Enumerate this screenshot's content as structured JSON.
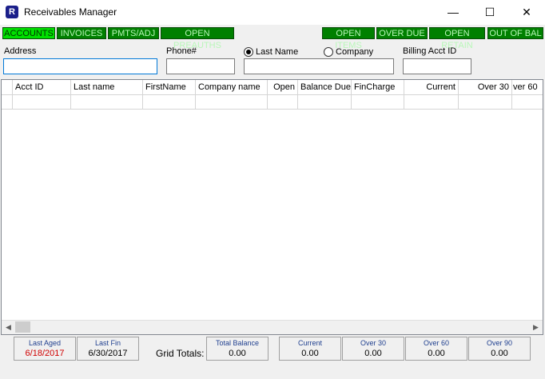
{
  "window": {
    "title": "Receivables Manager",
    "icon_letter": "R",
    "minimize": "—",
    "maximize": "☐",
    "close": "✕"
  },
  "tabs": {
    "accounts": "ACCOUNTS",
    "invoices": "INVOICES",
    "pmts_adj": "PMTS/ADJ",
    "open_preauths": "OPEN PREAUTHS",
    "open_items": "OPEN ITEMS",
    "over_due": "OVER DUE",
    "open_retain": "OPEN RETAIN",
    "out_of_bal": "OUT OF BAL"
  },
  "search": {
    "address_label": "Address",
    "address_value": "",
    "phone_label": "Phone#",
    "phone_value": "",
    "lastname_radio": "Last Name",
    "company_radio": "Company",
    "name_value": "",
    "billing_label": "Billing Acct ID",
    "billing_value": ""
  },
  "grid": {
    "columns": [
      "Acct ID",
      "Last name",
      "FirstName",
      "Company name",
      "Open",
      "Balance Due",
      "FinCharge",
      "Current",
      "Over 30",
      "ver 60"
    ]
  },
  "footer": {
    "last_aged_label": "Last Aged",
    "last_aged_value": "6/18/2017",
    "last_fin_label": "Last Fin",
    "last_fin_value": "6/30/2017",
    "grid_totals_label": "Grid Totals:",
    "total_balance_label": "Total Balance",
    "total_balance_value": "0.00",
    "current_label": "Current",
    "current_value": "0.00",
    "over30_label": "Over 30",
    "over30_value": "0.00",
    "over60_label": "Over 60",
    "over60_value": "0.00",
    "over90_label": "Over 90",
    "over90_value": "0.00"
  }
}
